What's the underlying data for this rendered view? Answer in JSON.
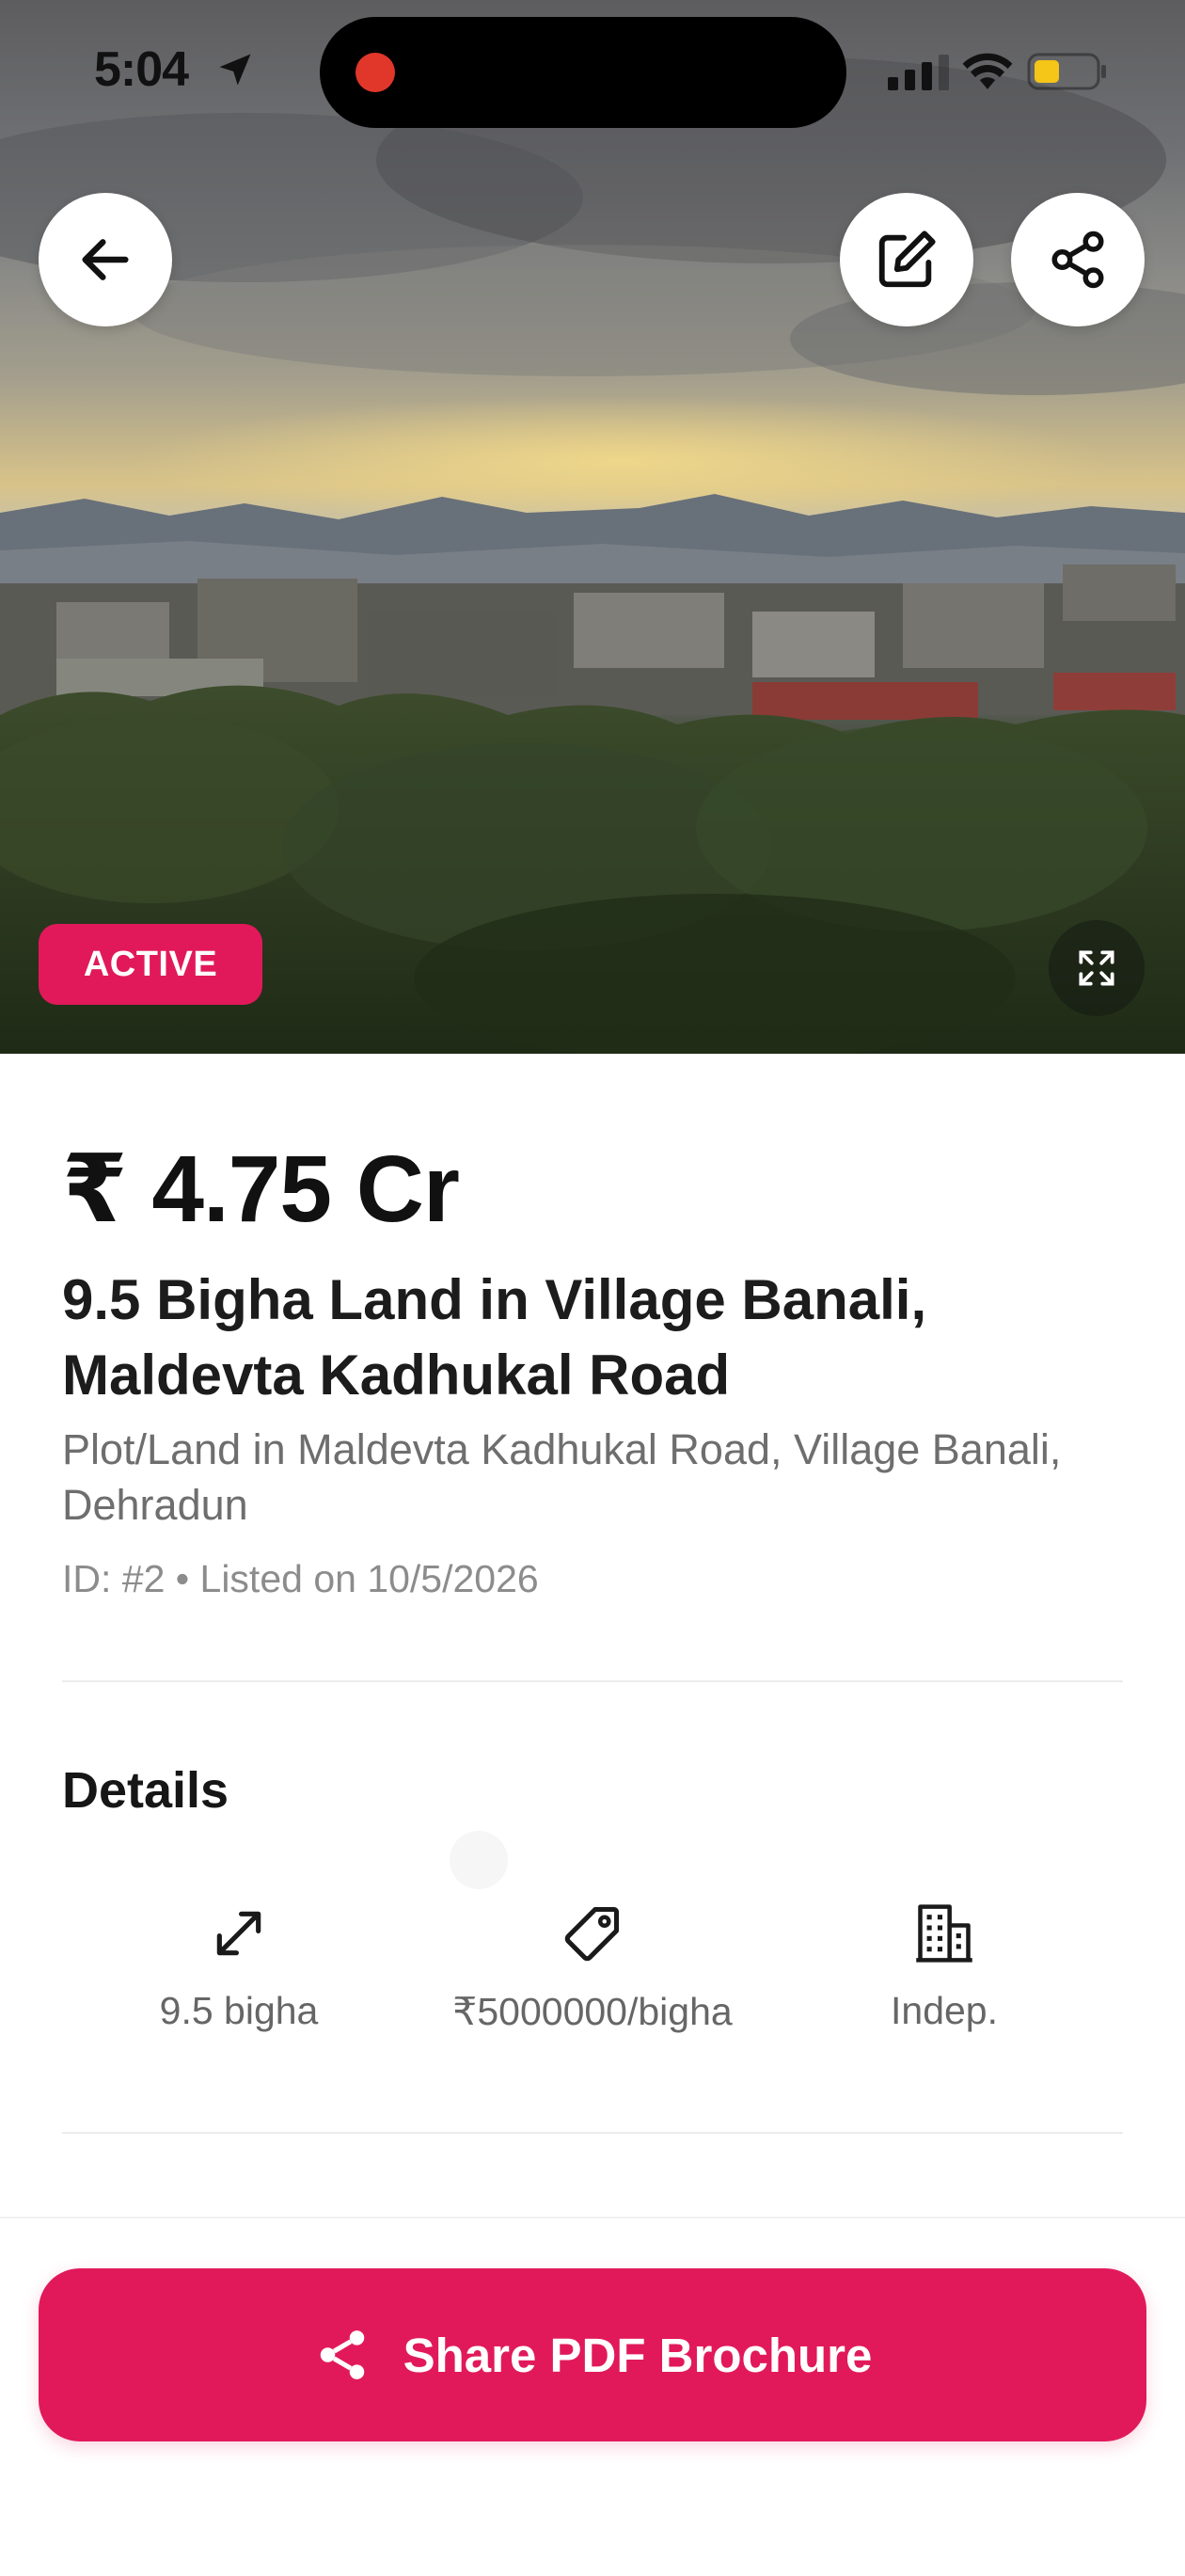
{
  "status_bar": {
    "time": "5:04",
    "location_icon": "location-arrow-icon",
    "signal_icon": "cellular-signal-icon",
    "wifi_icon": "wifi-icon",
    "battery_icon": "battery-low-icon",
    "recording_indicator_color": "#e0372a"
  },
  "hero": {
    "back_icon": "arrow-left-icon",
    "edit_icon": "edit-icon",
    "share_icon": "share-icon",
    "expand_icon": "expand-icon",
    "status_badge": "ACTIVE",
    "badge_color": "#e1195b"
  },
  "listing": {
    "price": "₹ 4.75 Cr",
    "title": "9.5 Bigha Land in Village Banali, Maldevta Kadhukal Road",
    "subtitle": "Plot/Land in Maldevta Kadhukal Road, Village Banali, Dehradun",
    "meta": "ID: #2 • Listed on 10/5/2026"
  },
  "details": {
    "heading": "Details",
    "items": [
      {
        "icon": "area-arrows-icon",
        "value": "9.5 bigha"
      },
      {
        "icon": "price-tag-icon",
        "value": "₹5000000/bigha"
      },
      {
        "icon": "building-icon",
        "value": "Indep."
      }
    ]
  },
  "footer": {
    "share_label": "Share PDF Brochure",
    "share_icon": "share-icon",
    "accent_color": "#e1195b"
  }
}
